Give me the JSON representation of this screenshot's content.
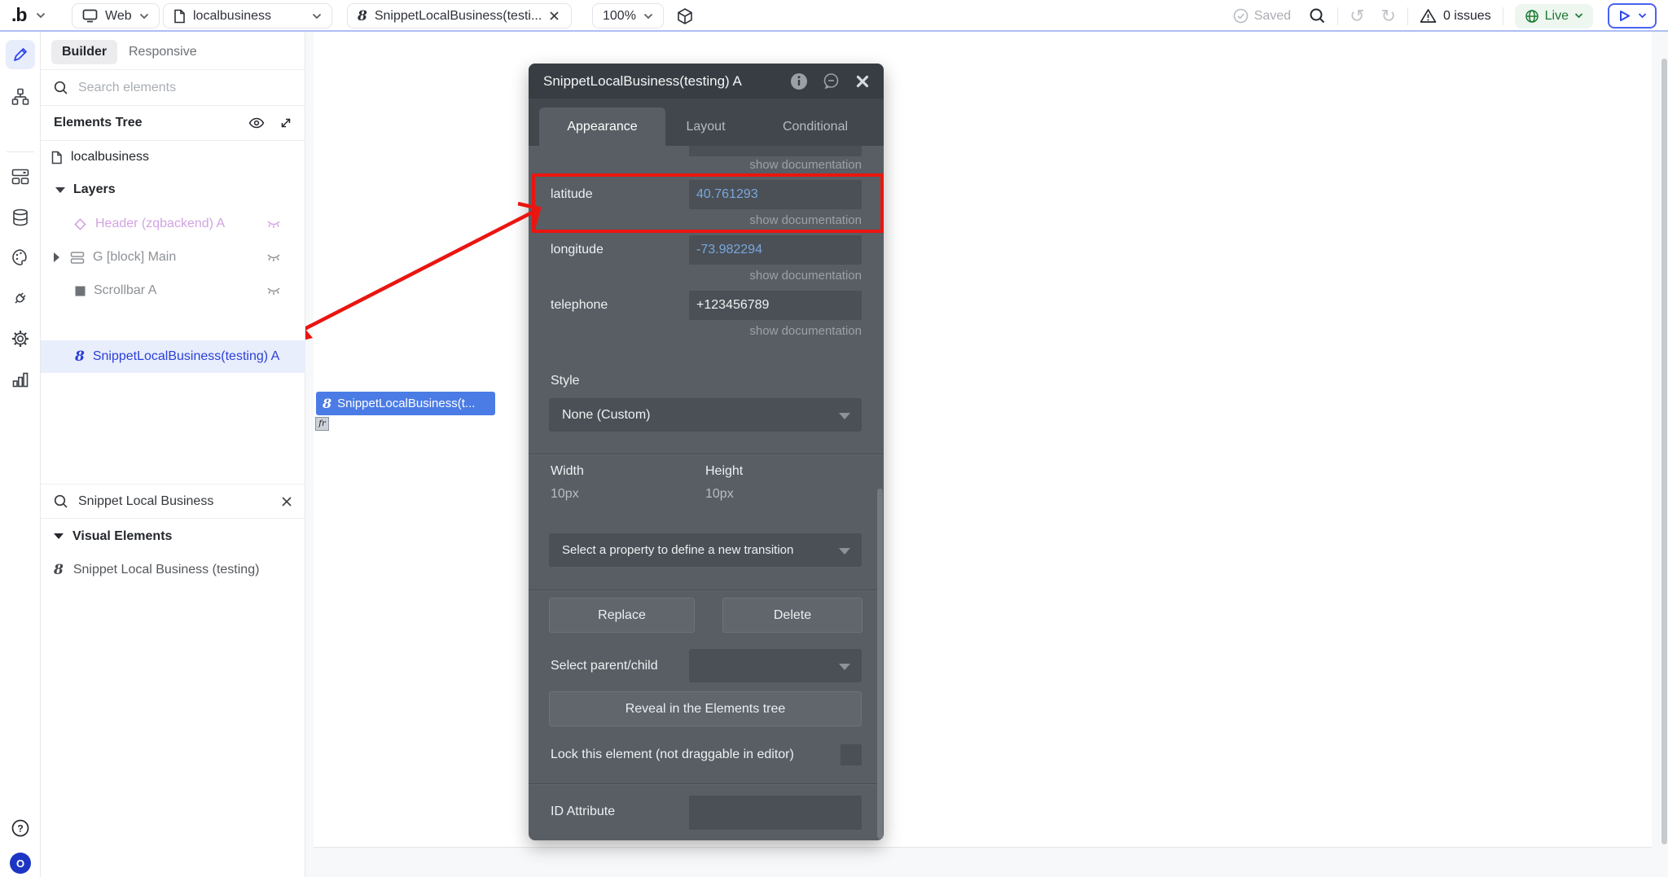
{
  "toolbar": {
    "logo": ".b",
    "platform_label": "Web",
    "page_name": "localbusiness",
    "open_tab_label": "SnippetLocalBusiness(testi...",
    "zoom_level": "100%",
    "saved_label": "Saved",
    "undo_glyph": "↺",
    "redo_glyph": "↻",
    "issues_label": "0 issues",
    "live_label": "Live"
  },
  "icons": {
    "snippet_glyph": "8"
  },
  "sidebar": {
    "items": [
      "design",
      "workflow",
      "components",
      "data",
      "styles",
      "plugins",
      "settings",
      "logs"
    ],
    "help": "?",
    "account_initial": "O"
  },
  "left_panel": {
    "builder_tab": "Builder",
    "responsive_tab": "Responsive",
    "search_placeholder": "Search elements",
    "elements_tree_title": "Elements Tree",
    "page_item": "localbusiness",
    "layers_title": "Layers",
    "layers": [
      {
        "label": "Header (zqbackend) A"
      },
      {
        "label": "G [block] Main"
      },
      {
        "label": "Scrollbar A"
      },
      {
        "label": "SnippetLocalBusiness(testing) A"
      }
    ],
    "element_search_value": "Snippet Local Business",
    "visual_elements_title": "Visual Elements",
    "visual_elements_item": "Snippet Local Business (testing)"
  },
  "canvas": {
    "selected_element_label": "SnippetLocalBusiness(t...",
    "element_placeholder_glyph": "fr"
  },
  "inspector": {
    "title": "SnippetLocalBusiness(testing) A",
    "tabs": [
      {
        "label": "Appearance"
      },
      {
        "label": "Layout"
      },
      {
        "label": "Conditional"
      }
    ],
    "show_documentation": "show documentation",
    "fields": [
      {
        "label": "latitude",
        "value": "40.761293"
      },
      {
        "label": "longitude",
        "value": "-73.982294"
      },
      {
        "label": "telephone",
        "value": "+123456789"
      }
    ],
    "style_section": {
      "label": "Style",
      "value": "None (Custom)"
    },
    "size": {
      "width_label": "Width",
      "width_value": "10px",
      "height_label": "Height",
      "height_value": "10px"
    },
    "transition_placeholder": "Select a property to define a new transition",
    "replace_button": "Replace",
    "delete_button": "Delete",
    "parent_child_label": "Select parent/child",
    "reveal_button": "Reveal in the Elements tree",
    "lock_label": "Lock this element (not draggable in editor)",
    "id_attribute_label": "ID Attribute"
  },
  "colors": {
    "accent_blue": "#2b47ee",
    "selection_blue": "#4b7ce5",
    "value_blue": "#77a7dd",
    "live_green": "#1d7a34",
    "annotation_red": "#ea1510",
    "inspector_bg": "#585e64",
    "inspector_header_bg": "#383d43"
  }
}
